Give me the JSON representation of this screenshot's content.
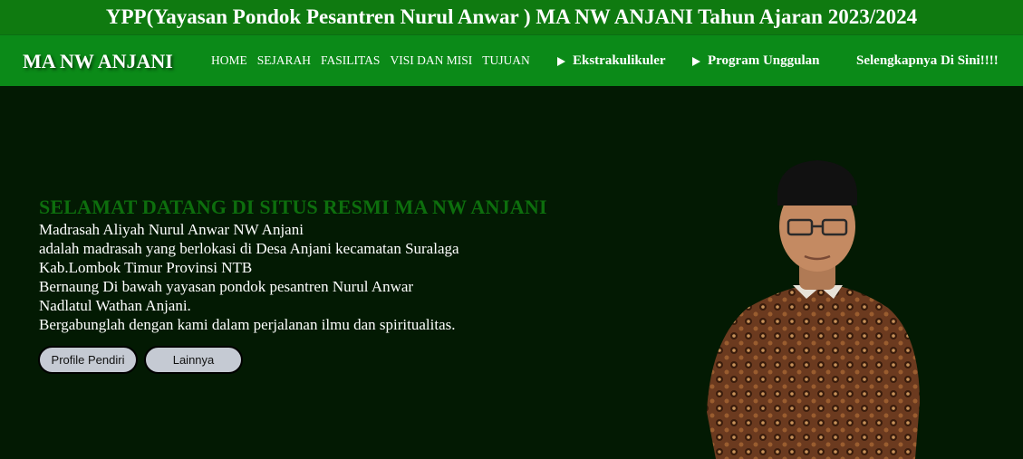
{
  "banner": {
    "title": "YPP(Yayasan Pondok Pesantren Nurul Anwar ) MA NW ANJANI Tahun Ajaran 2023/2024"
  },
  "navbar": {
    "brand": "MA NW ANJANI",
    "links": [
      "HOME",
      "SEJARAH",
      "FASILITAS",
      "VISI DAN MISI",
      "TUJUAN"
    ],
    "dropdowns": [
      "Ekstrakulikuler",
      "Program Unggulan"
    ],
    "more_link": "Selengkapnya Di Sini!!!!"
  },
  "hero": {
    "title": "SELAMAT DATANG DI SITUS RESMI MA NW ANJANI",
    "lines": [
      "Madrasah Aliyah Nurul Anwar NW Anjani",
      "adalah madrasah yang berlokasi di Desa Anjani kecamatan Suralaga",
      "Kab.Lombok Timur Provinsi NTB",
      "Bernaung Di bawah yayasan pondok pesantren Nurul Anwar",
      "Nadlatul Wathan Anjani.",
      "Bergabunglah dengan kami dalam perjalanan ilmu dan spiritualitas."
    ],
    "buttons": {
      "profile": "Profile Pendiri",
      "more": "Lainnya"
    }
  },
  "colors": {
    "banner_bg": "#0f7a10",
    "navbar_bg": "#0b8a18",
    "hero_bg": "#031a03",
    "hero_title": "#0d6e0d",
    "button_bg": "#c5cad3"
  }
}
